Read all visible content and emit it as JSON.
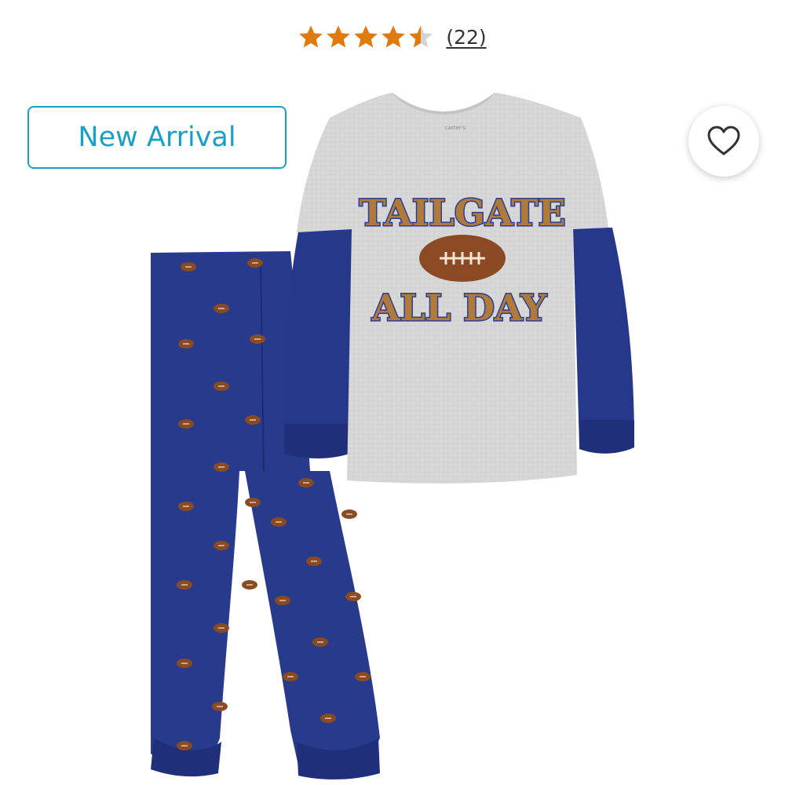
{
  "rating": {
    "value": 4.5,
    "max": 5,
    "count_label": "(22)",
    "star_color": "#e07a0c",
    "empty_star_color": "#d4d4d4"
  },
  "badge": {
    "label": "New Arrival",
    "color": "#1a9fc5"
  },
  "favorite": {
    "icon": "heart-outline-icon"
  },
  "product": {
    "shirt_line1": "TAILGATE",
    "shirt_line2": "ALL DAY",
    "shirt_tag": "carter's"
  }
}
